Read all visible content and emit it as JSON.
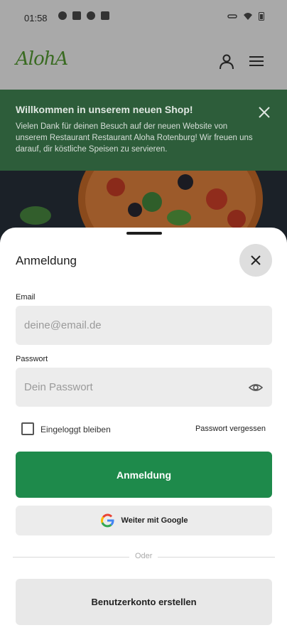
{
  "status_bar": {
    "time": "01:58"
  },
  "header": {
    "logo_text": "AlohA",
    "icons": [
      "account-icon",
      "menu-icon"
    ]
  },
  "banner": {
    "title": "Willkommen in unserem neuen Shop!",
    "text": "Vielen Dank für deinen Besuch auf der neuen Website von unserem Restaurant Restaurant Aloha Rotenburg! Wir freuen uns darauf, dir köstliche Speisen zu servieren."
  },
  "login": {
    "title": "Anmeldung",
    "email_label": "Email",
    "email_placeholder": "deine@email.de",
    "password_label": "Passwort",
    "password_placeholder": "Dein Passwort",
    "remember_label": "Eingeloggt bleiben",
    "remember_checked": false,
    "forgot_label": "Passwort vergessen",
    "submit_label": "Anmeldung",
    "google_label": "Weiter mit Google",
    "divider_label": "Oder",
    "create_account_label": "Benutzerkonto erstellen"
  },
  "colors": {
    "primary": "#1e8a4b",
    "banner_bg": "#2d5d3a"
  }
}
